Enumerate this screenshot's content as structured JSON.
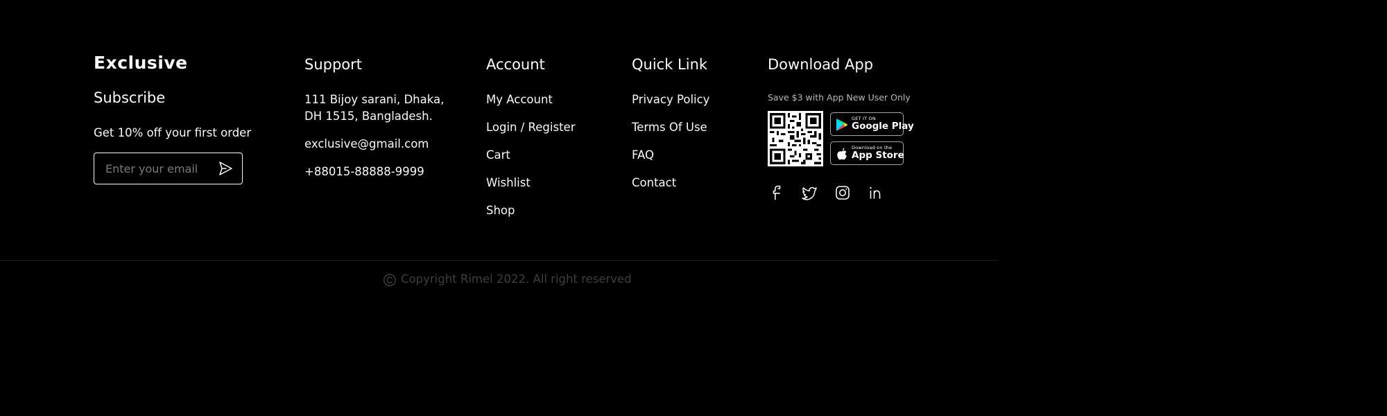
{
  "brand": {
    "name": "Exclusive"
  },
  "subscribe": {
    "title": "Subscribe",
    "offer": "Get 10% off your first order",
    "email_placeholder": "Enter your email"
  },
  "support": {
    "title": "Support",
    "address_line1": "111 Bijoy sarani, Dhaka,",
    "address_line2": "DH 1515, Bangladesh.",
    "email": "exclusive@gmail.com",
    "phone": "+88015-88888-9999"
  },
  "account": {
    "title": "Account",
    "links": [
      "My Account",
      "Login / Register",
      "Cart",
      "Wishlist",
      "Shop"
    ]
  },
  "quick_link": {
    "title": "Quick Link",
    "links": [
      "Privacy Policy",
      "Terms Of Use",
      "FAQ",
      "Contact"
    ]
  },
  "download_app": {
    "title": "Download App",
    "promo": "Save $3 with App New User Only",
    "google_play": {
      "small": "GET IT ON",
      "big": "Google Play"
    },
    "app_store": {
      "small": "Download on the",
      "big": "App Store"
    }
  },
  "social_icons": [
    "facebook-icon",
    "twitter-icon",
    "instagram-icon",
    "linkedin-icon"
  ],
  "copyright": {
    "text": "Copyright Rimel 2022. All right reserved"
  },
  "colors": {
    "background": "#000000",
    "text": "#FAFAFA",
    "muted": "#3D3D3D",
    "divider": "#1F1F1F"
  }
}
